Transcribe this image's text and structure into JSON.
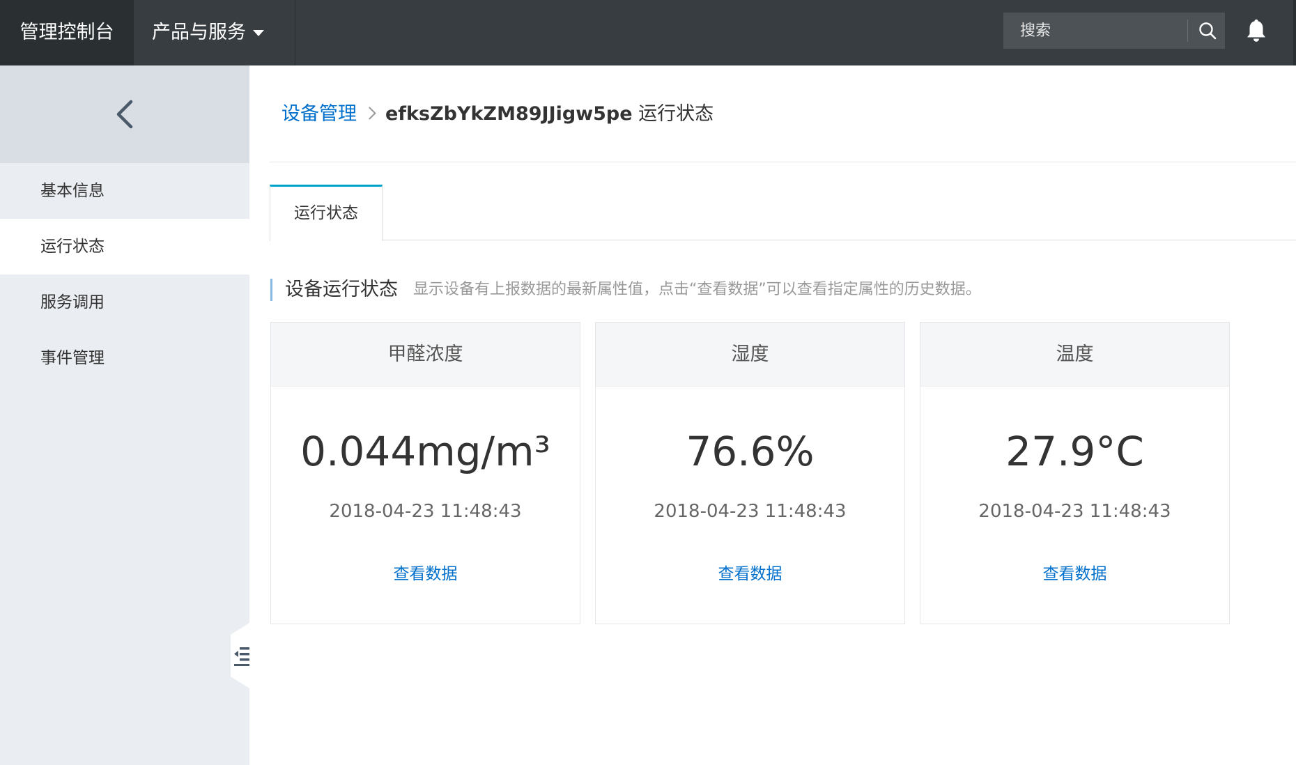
{
  "topbar": {
    "brand": "管理控制台",
    "product_menu": "产品与服务",
    "search_placeholder": "搜索",
    "icons": [
      "caret-down-icon",
      "search-icon",
      "bell-icon"
    ]
  },
  "sidebar": {
    "items": [
      {
        "label": "基本信息",
        "active": false
      },
      {
        "label": "运行状态",
        "active": true
      },
      {
        "label": "服务调用",
        "active": false
      },
      {
        "label": "事件管理",
        "active": false
      }
    ],
    "icons": [
      "chevron-left-icon",
      "menu-collapse-icon"
    ]
  },
  "breadcrumb": {
    "parent": "设备管理",
    "device": "efksZbYkZM89JJigw5pe",
    "page": "运行状态"
  },
  "tabs": [
    {
      "label": "运行状态",
      "active": true
    }
  ],
  "section": {
    "title": "设备运行状态",
    "description": "显示设备有上报数据的最新属性值，点击“查看数据”可以查看指定属性的历史数据。"
  },
  "cards": [
    {
      "name": "甲醛浓度",
      "value": "0.044mg/m³",
      "time": "2018-04-23 11:48:43",
      "link": "查看数据"
    },
    {
      "name": "湿度",
      "value": "76.6%",
      "time": "2018-04-23 11:48:43",
      "link": "查看数据"
    },
    {
      "name": "温度",
      "value": "27.9°C",
      "time": "2018-04-23 11:48:43",
      "link": "查看数据"
    }
  ],
  "colors": {
    "topbar": "#373d41",
    "link": "#0070cc",
    "tab_accent": "#00a2ca"
  }
}
